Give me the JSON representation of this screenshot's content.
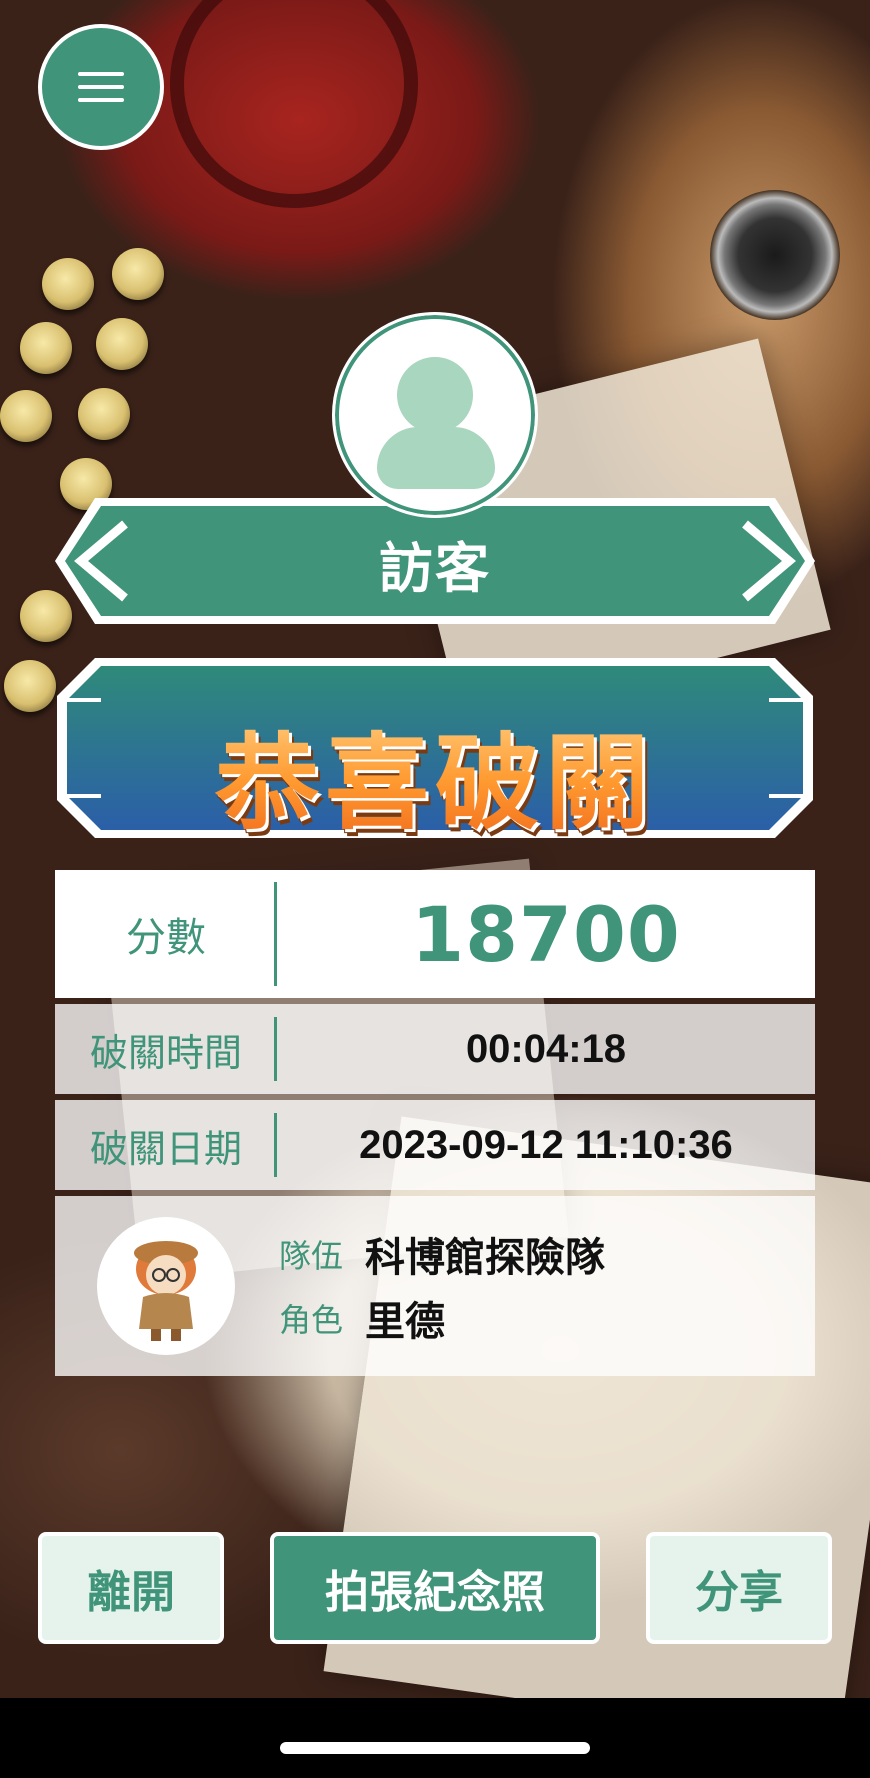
{
  "header": {
    "menu_icon": "hamburger-icon"
  },
  "profile": {
    "avatar_icon": "user-avatar-icon",
    "name": "訪客",
    "prev_icon": "chevron-left-icon",
    "next_icon": "chevron-right-icon"
  },
  "banner": {
    "title": "恭喜破關"
  },
  "result": {
    "score_label": "分數",
    "score_value": "18700",
    "time_label": "破關時間",
    "time_value": "00:04:18",
    "date_label": "破關日期",
    "date_value": "2023-09-12 11:10:36"
  },
  "team": {
    "mascot_icon": "detective-character-icon",
    "team_label": "隊伍",
    "team_value": "科博館探險隊",
    "role_label": "角色",
    "role_value": "里德"
  },
  "actions": {
    "leave_label": "離開",
    "photo_label": "拍張紀念照",
    "share_label": "分享"
  },
  "colors": {
    "accent": "#3f9479",
    "banner_blue": "#2b5fa8",
    "title_orange": "#ff9a30"
  }
}
